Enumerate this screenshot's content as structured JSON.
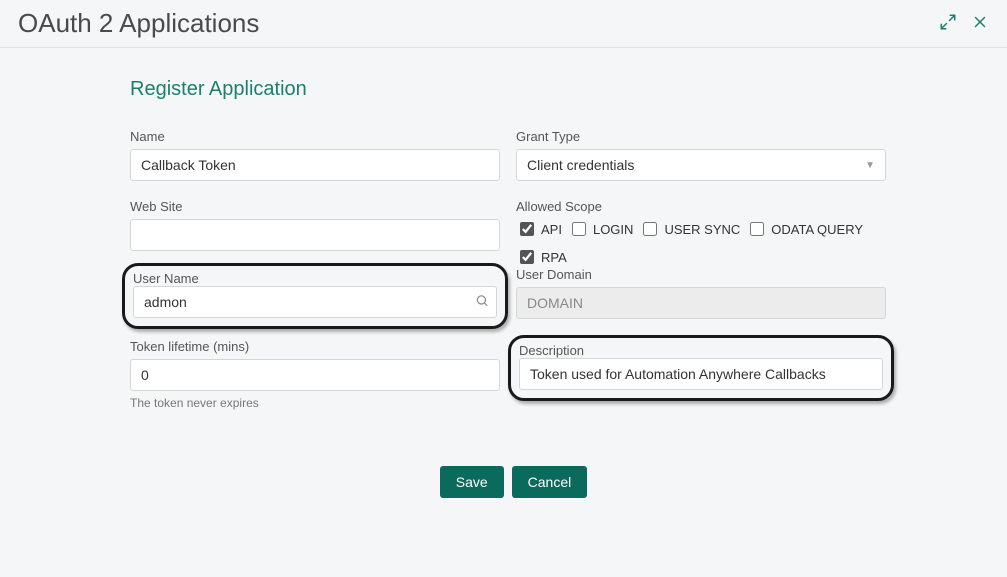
{
  "header": {
    "title": "OAuth 2 Applications"
  },
  "form": {
    "title": "Register Application",
    "name_label": "Name",
    "name_value": "Callback Token",
    "grant_type_label": "Grant Type",
    "grant_type_value": "Client credentials",
    "website_label": "Web Site",
    "website_value": "",
    "allowed_scope_label": "Allowed Scope",
    "scopes": {
      "api": {
        "label": "API",
        "checked": true
      },
      "login": {
        "label": "LOGIN",
        "checked": false
      },
      "usersync": {
        "label": "USER SYNC",
        "checked": false
      },
      "odata": {
        "label": "ODATA QUERY",
        "checked": false
      },
      "rpa": {
        "label": "RPA",
        "checked": true
      }
    },
    "username_label": "User Name",
    "username_value": "admon",
    "userdomain_label": "User Domain",
    "userdomain_value": "DOMAIN",
    "token_lifetime_label": "Token lifetime (mins)",
    "token_lifetime_value": "0",
    "token_lifetime_helper": "The token never expires",
    "description_label": "Description",
    "description_value": "Token used for Automation Anywhere Callbacks"
  },
  "buttons": {
    "save": "Save",
    "cancel": "Cancel"
  }
}
